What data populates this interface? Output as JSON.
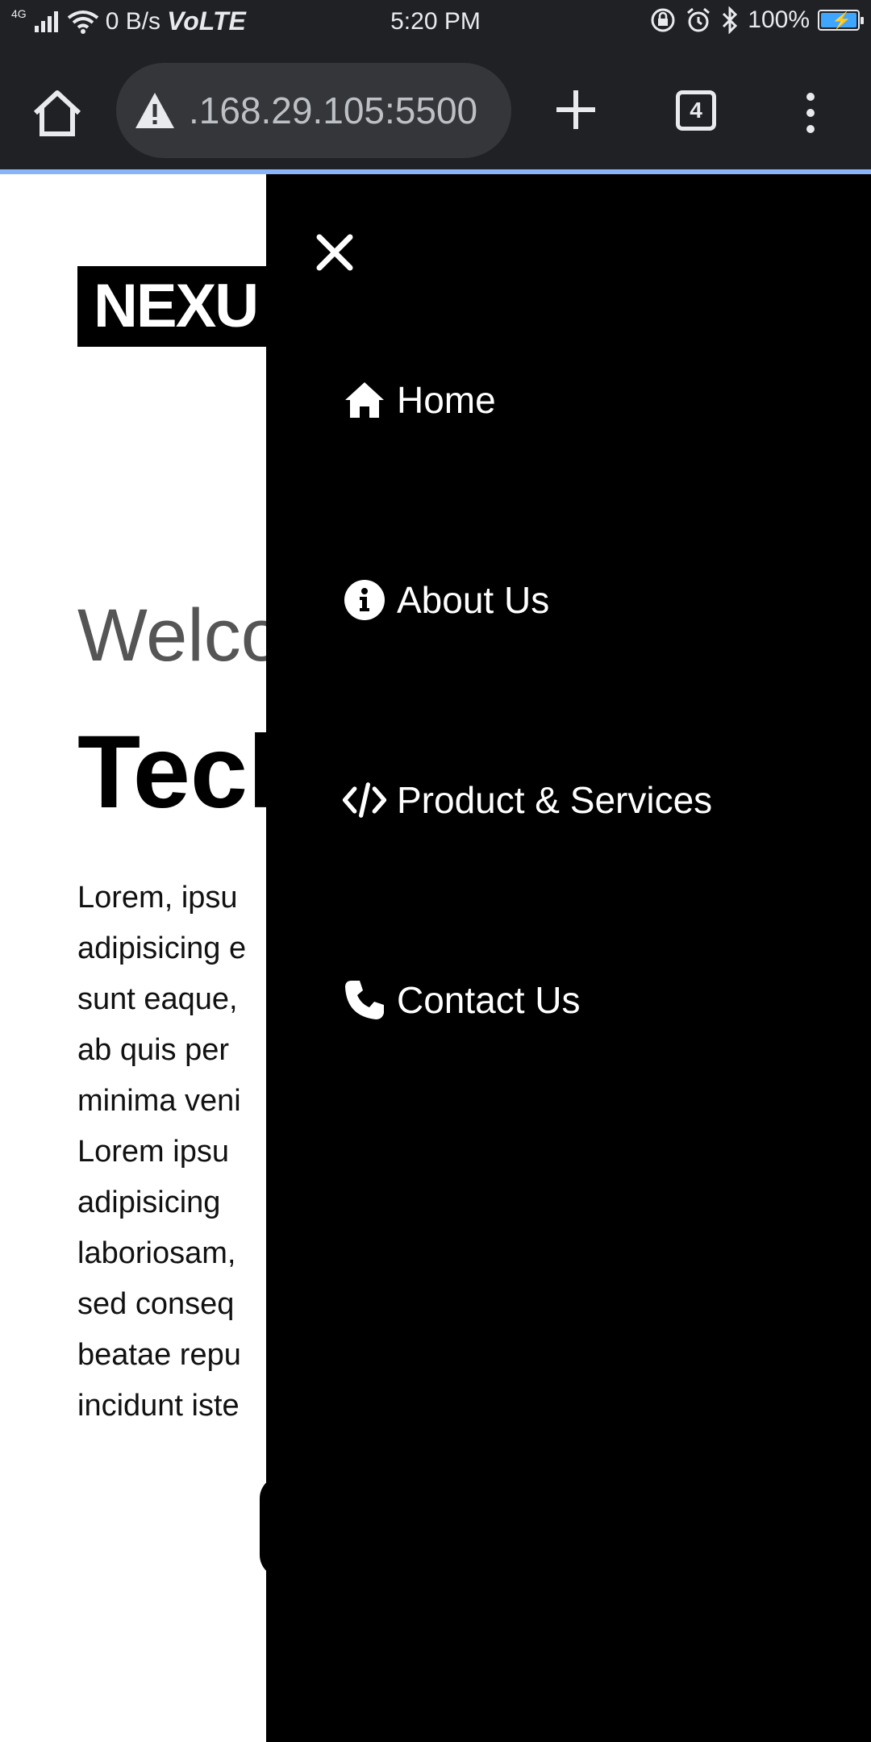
{
  "status_bar": {
    "network": "4G",
    "speed": "0 B/s",
    "volte": "VoLTE",
    "time": "5:20 PM",
    "battery": "100%",
    "icons": [
      "signal-icon",
      "wifi-icon",
      "lock-rotation-icon",
      "alarm-icon",
      "bluetooth-icon",
      "battery-charging-icon"
    ]
  },
  "browser": {
    "url": ".168.29.105:5500",
    "tab_count": "4",
    "icons": [
      "home-icon",
      "warning-icon",
      "plus-icon",
      "tabs-icon",
      "more-vert-icon"
    ]
  },
  "page": {
    "logo_text": "NEXU",
    "welcome": "Welco",
    "headline": "Tech",
    "body_lines": [
      "Lorem,   ipsu",
      "adipisicing e",
      "sunt eaque,",
      "ab  quis  per",
      "minima  veni",
      "Lorem   ipsu",
      "adipisicing",
      "laboriosam,",
      "sed  conseq",
      "beatae  repu",
      "incidunt iste"
    ]
  },
  "side_menu": {
    "background": "#000000",
    "close_icon": "close-icon",
    "items": [
      {
        "label": "Home",
        "icon": "home-icon"
      },
      {
        "label": "About Us",
        "icon": "info-icon"
      },
      {
        "label": "Product & Services",
        "icon": "code-icon"
      },
      {
        "label": "Contact Us",
        "icon": "phone-icon"
      }
    ]
  }
}
